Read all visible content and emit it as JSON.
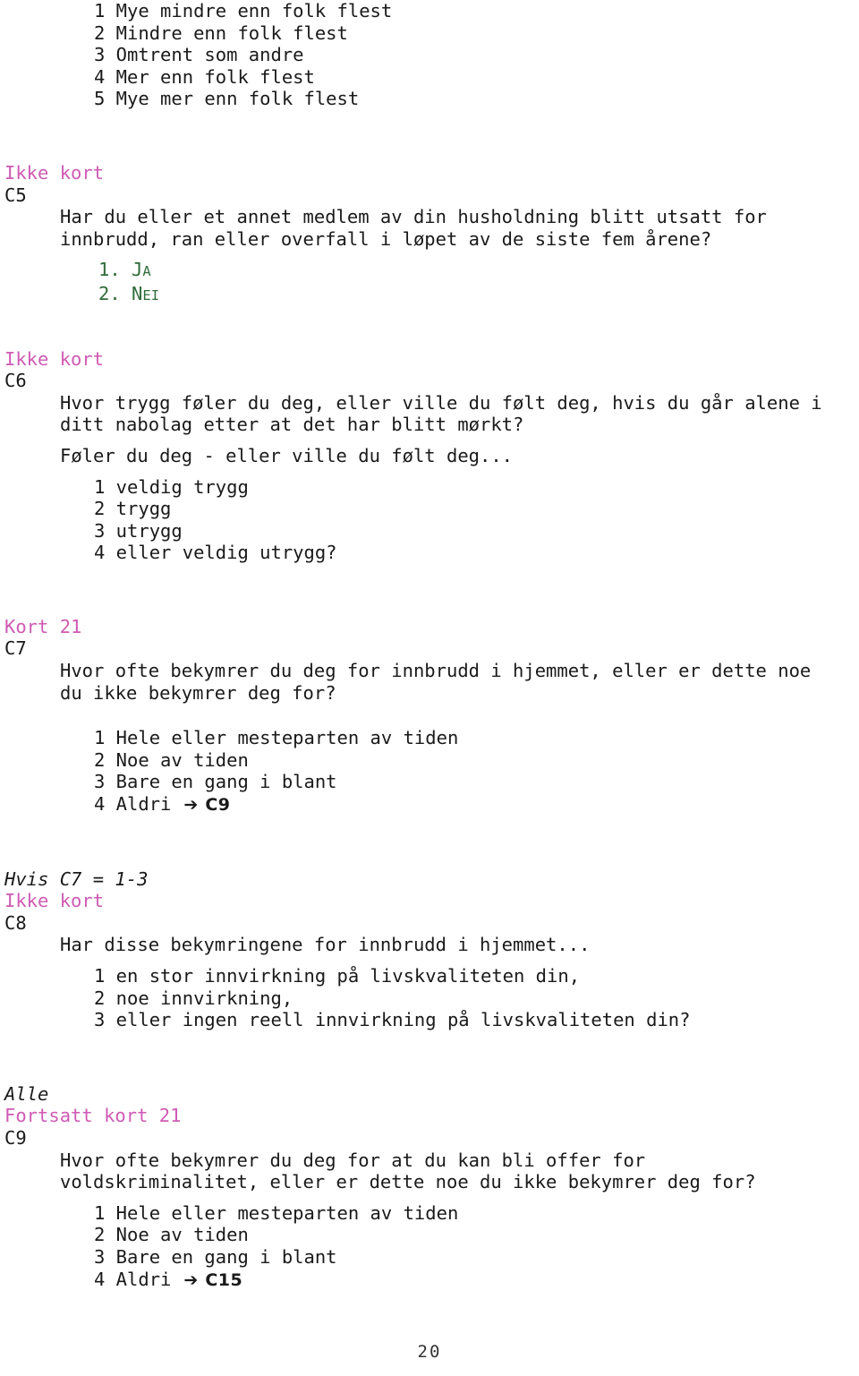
{
  "document": {
    "page_number": "20",
    "colors": {
      "routing_label": "#cf5bb4",
      "yes_no_options": "#2f6b3a",
      "body_text": "#1a1a1a"
    }
  },
  "top_scale_options": [
    "1 Mye mindre enn folk flest",
    "2 Mindre enn folk flest",
    "3 Omtrent som andre",
    "4 Mer enn folk flest",
    "5 Mye mer enn folk flest"
  ],
  "questions": [
    {
      "id": "c5",
      "card_label": "Ikke kort",
      "code": "C5",
      "condition": null,
      "text_lines": [
        "Har du eller et annet medlem av din husholdning blitt utsatt for",
        "innbrudd, ran eller overfall i løpet av de siste fem årene?"
      ],
      "intro_lines": [],
      "options": [
        {
          "num": "1.",
          "first": "J",
          "rest": "A",
          "goto": null
        },
        {
          "num": "2.",
          "first": "N",
          "rest": "EI",
          "goto": null
        }
      ],
      "option_style": "smallcaps-green"
    },
    {
      "id": "c6",
      "card_label": "Ikke kort",
      "code": "C6",
      "condition": null,
      "text_lines": [
        "Hvor trygg føler du deg, eller ville du følt deg, hvis du går alene i",
        "ditt nabolag etter at det har blitt mørkt?"
      ],
      "intro_lines": [
        "Føler du deg - eller ville du følt deg..."
      ],
      "options": [
        {
          "label": "1 veldig trygg",
          "goto": null
        },
        {
          "label": "2 trygg",
          "goto": null
        },
        {
          "label": "3 utrygg",
          "goto": null
        },
        {
          "label": "4 eller veldig utrygg?",
          "goto": null
        }
      ],
      "option_style": "plain"
    },
    {
      "id": "c7",
      "card_label": "Kort 21",
      "code": "C7",
      "condition": null,
      "text_lines": [
        "Hvor ofte bekymrer du deg for innbrudd i hjemmet, eller er dette noe",
        "du ikke bekymrer deg for?"
      ],
      "intro_lines": [],
      "options": [
        {
          "label": "1 Hele eller mesteparten av tiden",
          "goto": null
        },
        {
          "label": "2 Noe av tiden",
          "goto": null
        },
        {
          "label": "3 Bare en gang i blant",
          "goto": null
        },
        {
          "label": "4 Aldri",
          "goto": "C9",
          "arrow": "➔"
        }
      ],
      "option_style": "plain"
    },
    {
      "id": "c8",
      "card_label": "Ikke kort",
      "code": "C8",
      "condition": "Hvis C7 = 1-3",
      "text_lines": [
        "Har disse bekymringene for innbrudd i hjemmet..."
      ],
      "intro_lines": [],
      "options": [
        {
          "label": "1 en stor innvirkning på livskvaliteten din,",
          "goto": null
        },
        {
          "label": "2 noe innvirkning,",
          "goto": null
        },
        {
          "label": "3 eller ingen reell innvirkning på livskvaliteten din?",
          "goto": null
        }
      ],
      "option_style": "plain"
    },
    {
      "id": "c9",
      "card_label": "Fortsatt kort 21",
      "code": "C9",
      "condition": "Alle",
      "text_lines": [
        "Hvor ofte bekymrer du deg for at du kan bli offer for",
        "voldskriminalitet, eller er dette noe du ikke bekymrer deg for?"
      ],
      "intro_lines": [],
      "options": [
        {
          "label": "1 Hele eller mesteparten av tiden",
          "goto": null
        },
        {
          "label": "2 Noe av tiden",
          "goto": null
        },
        {
          "label": "3 Bare en gang i blant",
          "goto": null
        },
        {
          "label": "4 Aldri",
          "goto": "C15",
          "arrow": "➔"
        }
      ],
      "option_style": "plain"
    }
  ]
}
